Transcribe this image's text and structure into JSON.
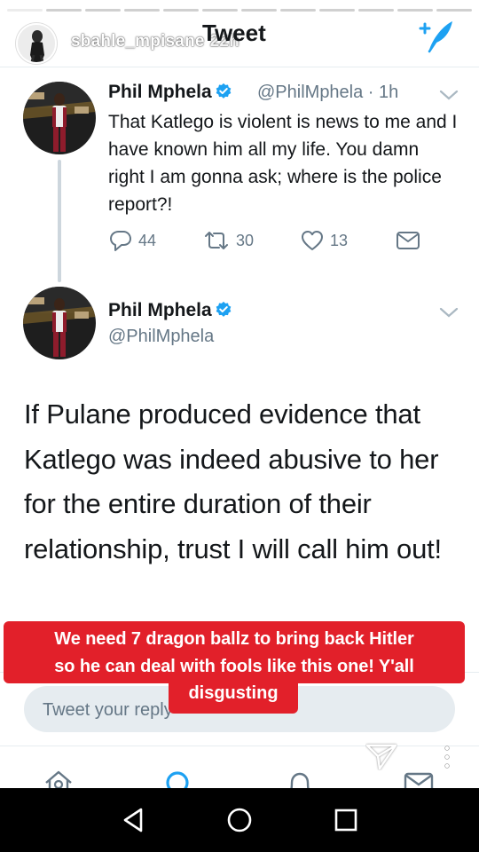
{
  "story": {
    "username": "sbahle_mpisane",
    "age": "22h",
    "progress_segments": 12,
    "progress_completed": 1
  },
  "header": {
    "title": "Tweet"
  },
  "tweet_parent": {
    "name": "Phil Mphela",
    "handle_time": "@PhilMphela · 1h",
    "text": "That Katlego is violent is news to me and I have known him all my life. You damn right I am gonna ask; where is the police report?!",
    "replies": "44",
    "retweets": "30",
    "likes": "13"
  },
  "tweet_main": {
    "name": "Phil Mphela",
    "handle": "@PhilMphela",
    "text": "If Pulane produced evidence that Katlego was indeed abusive to her for the entire duration of their relationship, trust I will call him out!"
  },
  "reply": {
    "placeholder": "Tweet your reply"
  },
  "caption": {
    "line1": "We need 7 dragon ballz to bring back Hitler",
    "line2": "so he can deal with fools like this one! Y'all",
    "line3": "disgusting"
  },
  "colors": {
    "twitter_blue": "#1da1f2",
    "caption_red": "#e2202a"
  }
}
